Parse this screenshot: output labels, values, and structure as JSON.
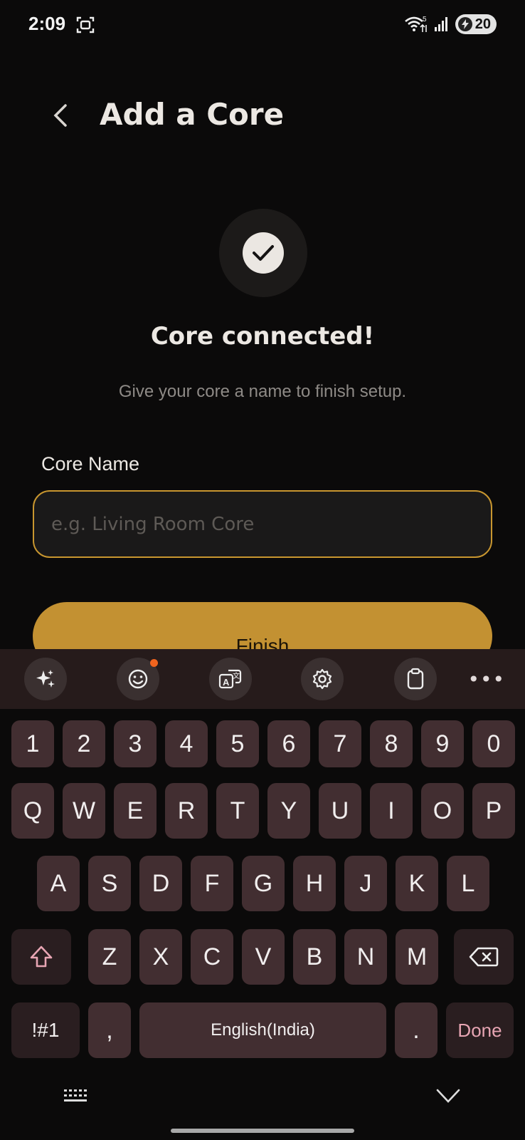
{
  "status": {
    "time": "2:09",
    "battery": "20",
    "wifi_badge": "5"
  },
  "header": {
    "title": "Add a Core"
  },
  "success": {
    "headline": "Core connected!",
    "subtext": "Give your core a name to finish setup."
  },
  "form": {
    "label": "Core Name",
    "placeholder": "e.g. Living Room Core",
    "value": "",
    "finish_label": "Finish"
  },
  "keyboard": {
    "toolbar_icons": [
      "sparkle-icon",
      "emoji-icon",
      "translate-icon",
      "settings-icon",
      "clipboard-icon",
      "more-icon"
    ],
    "more_label": "•••",
    "row_numbers": [
      "1",
      "2",
      "3",
      "4",
      "5",
      "6",
      "7",
      "8",
      "9",
      "0"
    ],
    "row_q": [
      "Q",
      "W",
      "E",
      "R",
      "T",
      "Y",
      "U",
      "I",
      "O",
      "P"
    ],
    "row_a": [
      "A",
      "S",
      "D",
      "F",
      "G",
      "H",
      "J",
      "K",
      "L"
    ],
    "row_z": [
      "Z",
      "X",
      "C",
      "V",
      "B",
      "N",
      "M"
    ],
    "symbols_label": "!#1",
    "comma_label": ",",
    "space_label": "English(India)",
    "period_label": ".",
    "done_label": "Done"
  },
  "colors": {
    "accent": "#c39132",
    "background": "#0b0a0a",
    "key": "#422e31",
    "done_text": "#e7a5b3"
  }
}
